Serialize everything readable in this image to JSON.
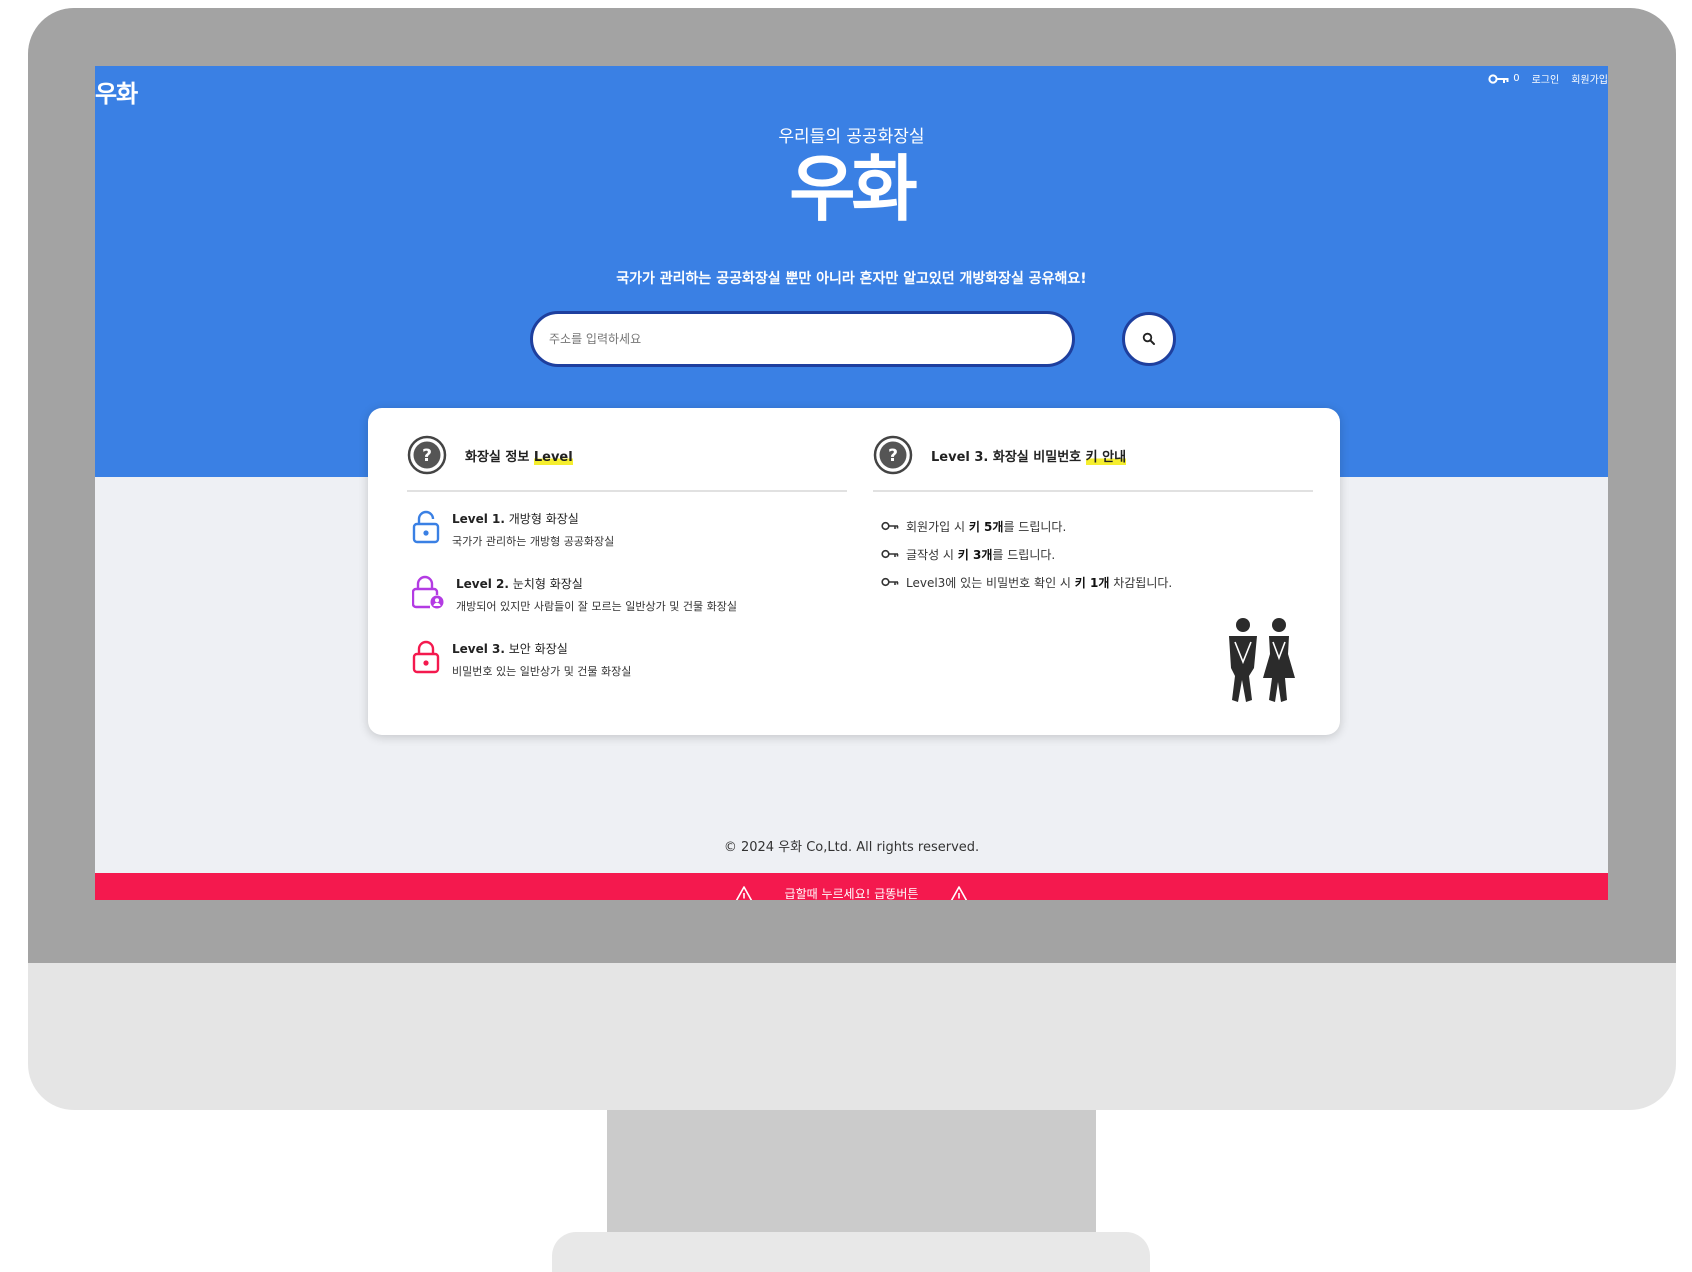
{
  "header": {
    "logo": "우화",
    "key_count": "0",
    "login_label": "로그인",
    "signup_label": "회원가입"
  },
  "hero": {
    "subtitle": "우리들의 공공화장실",
    "title": "우화",
    "description": "국가가 관리하는 공공화장실 뿐만 아니라 혼자만 알고있던 개방화장실 공유해요!"
  },
  "search": {
    "placeholder": "주소를 입력하세요"
  },
  "info_card": {
    "levels": {
      "title_prefix": "화장실 정보 ",
      "title_highlight": "Level",
      "items": [
        {
          "level": "Level 1.",
          "name": " 개방형 화장실",
          "desc": "국가가 관리하는 개방형 공공화장실",
          "color": "#3a80e4",
          "icon": "unlocked-lock-icon"
        },
        {
          "level": "Level 2.",
          "name": " 눈치형 화장실",
          "desc": "개방되어 있지만 사람들이 잘 모르는 일반상가 및 건물 화장실",
          "color": "#b33be3",
          "icon": "user-lock-icon"
        },
        {
          "level": "Level 3.",
          "name": " 보안 화장실",
          "desc": "비밀번호 있는 일반상가 및 건물 화장실",
          "color": "#f4194e",
          "icon": "locked-lock-icon"
        }
      ]
    },
    "keys": {
      "title_prefix": "Level 3. 화장실 비밀번호 ",
      "title_highlight": "키 안내",
      "items": [
        {
          "pre": "회원가입 시 ",
          "bold": "키 5개",
          "post": "를 드립니다."
        },
        {
          "pre": "글작성 시 ",
          "bold": "키 3개",
          "post": "를 드립니다."
        },
        {
          "pre": "Level3에 있는 비밀번호 확인 시 ",
          "bold": "키 1개",
          "post": " 차감됩니다."
        }
      ]
    }
  },
  "footer": {
    "copyright": "© 2024 우화 Co,Ltd. All rights reserved.",
    "emergency_label": "급할때 누르세요! 급똥버튼"
  },
  "colors": {
    "primary": "#3a80e4",
    "search_border": "#1e3f9e",
    "emergency": "#f4194e",
    "highlight": "#f5ee2e"
  }
}
